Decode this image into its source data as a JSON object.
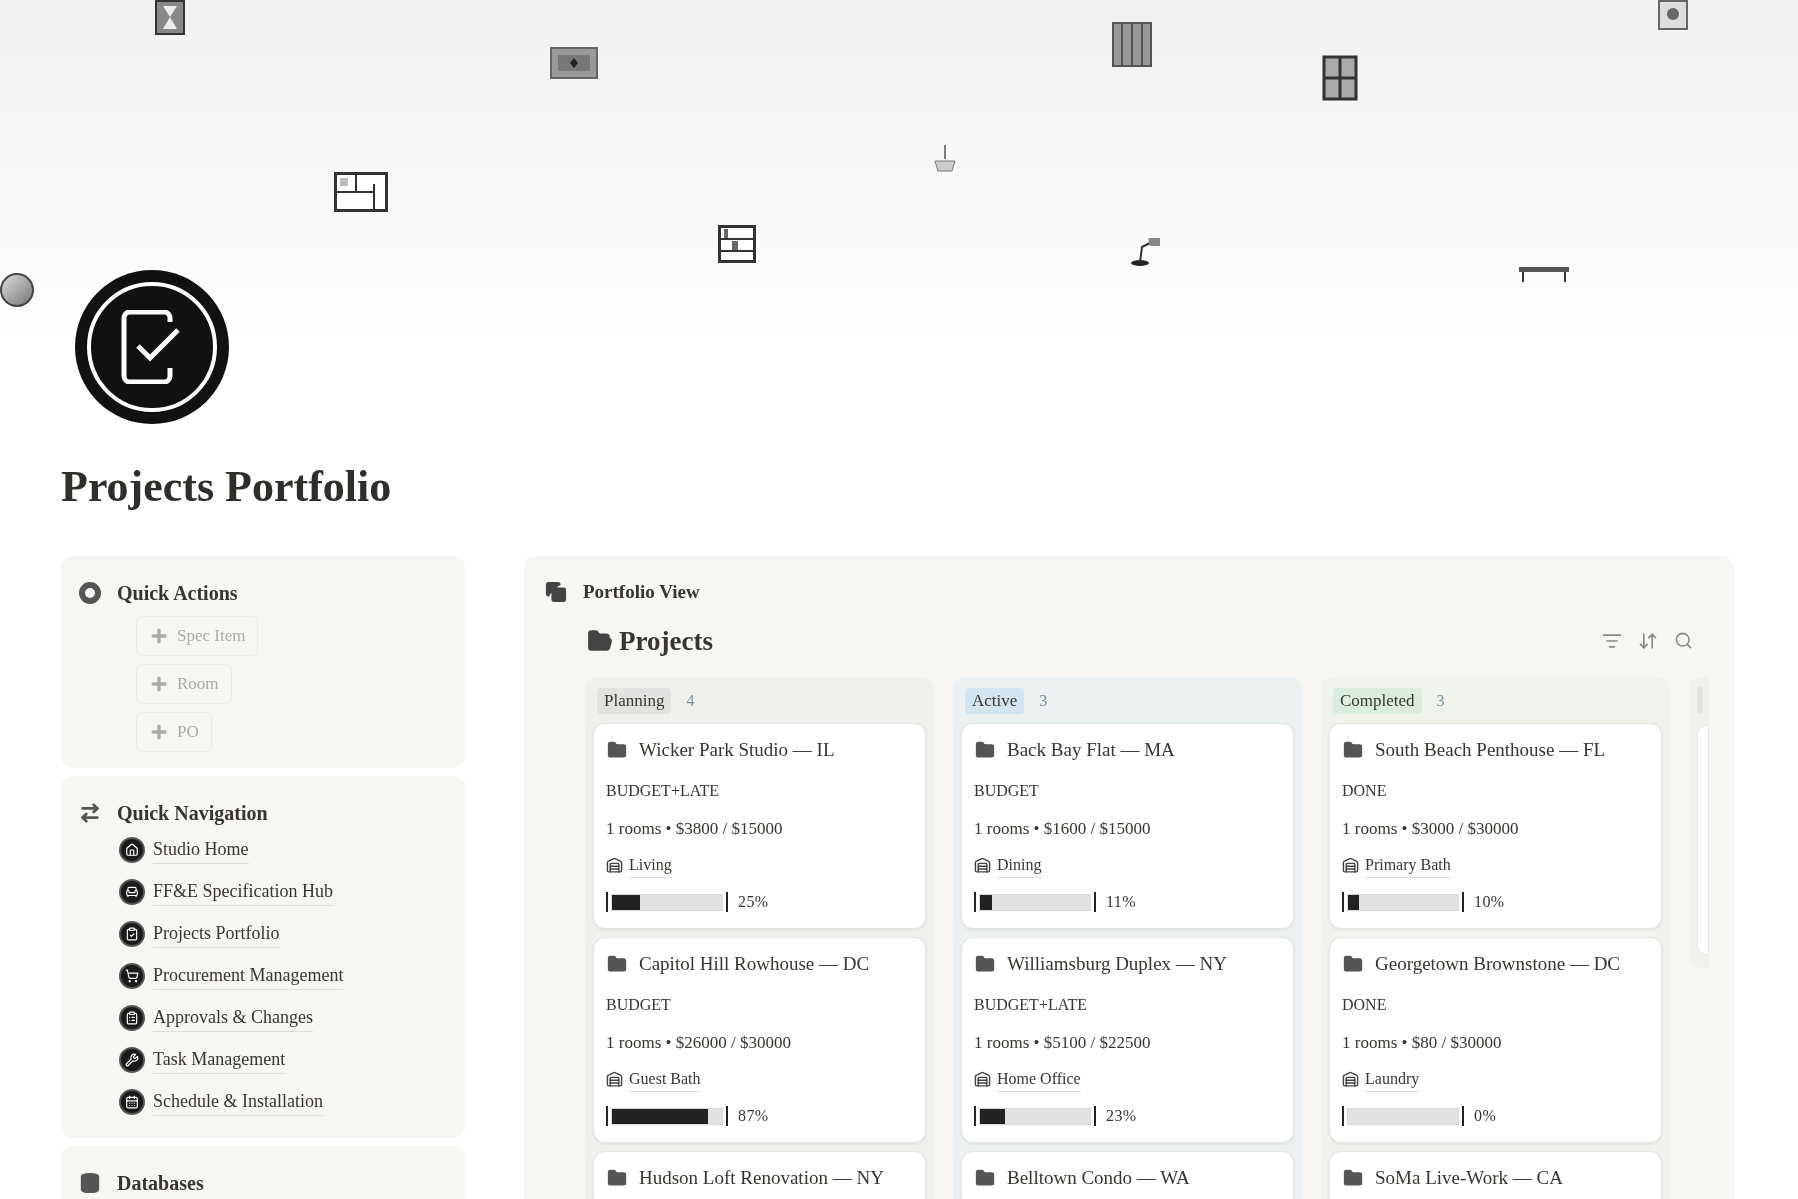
{
  "page": {
    "title": "Projects Portfolio"
  },
  "quick_actions": {
    "title": "Quick Actions",
    "buttons": [
      {
        "label": "Spec Item"
      },
      {
        "label": "Room"
      },
      {
        "label": "PO"
      }
    ]
  },
  "quick_navigation": {
    "title": "Quick Navigation",
    "links": [
      {
        "label": "Studio Home"
      },
      {
        "label": "FF&E Specification Hub"
      },
      {
        "label": "Projects Portfolio"
      },
      {
        "label": "Procurement Management"
      },
      {
        "label": "Approvals & Changes"
      },
      {
        "label": "Task Management"
      },
      {
        "label": "Schedule & Installation"
      }
    ]
  },
  "databases": {
    "title": "Databases"
  },
  "portfolio": {
    "title": "Portfolio View",
    "database_title": "Projects",
    "columns": [
      {
        "label": "Planning",
        "count": "4",
        "color": "#e3e2e0",
        "cards": [
          {
            "title": "Wicker Park Studio — IL",
            "status": "BUDGET+LATE",
            "summary": "1 rooms • $3800 / $15000",
            "room": "Living",
            "level": 0.25,
            "reading": "25%"
          },
          {
            "title": "Capitol Hill Rowhouse — DC",
            "status": "BUDGET",
            "summary": "1 rooms • $26000 / $30000",
            "room": "Guest Bath",
            "level": 0.87,
            "reading": "87%"
          },
          {
            "title": "Hudson Loft Renovation — NY"
          }
        ]
      },
      {
        "label": "Active",
        "count": "3",
        "color": "#d3e5ef",
        "cards": [
          {
            "title": "Back Bay Flat — MA",
            "status": "BUDGET",
            "summary": "1 rooms • $1600 / $15000",
            "room": "Dining",
            "level": 0.11,
            "reading": "11%"
          },
          {
            "title": "Williamsburg Duplex — NY",
            "status": "BUDGET+LATE",
            "summary": "1 rooms • $5100 / $22500",
            "room": "Home Office",
            "level": 0.23,
            "reading": "23%"
          },
          {
            "title": "Belltown Condo — WA"
          }
        ]
      },
      {
        "label": "Completed",
        "count": "3",
        "color": "#dbeddb",
        "cards": [
          {
            "title": "South Beach Penthouse — FL",
            "status": "DONE",
            "summary": "1 rooms • $3000 / $30000",
            "room": "Primary Bath",
            "level": 0.1,
            "reading": "10%"
          },
          {
            "title": "Georgetown Brownstone — DC",
            "status": "DONE",
            "summary": "1 rooms • $80 / $30000",
            "room": "Laundry",
            "level": 0,
            "reading": "0%"
          },
          {
            "title": "SoMa Live-Work — CA"
          }
        ]
      }
    ]
  }
}
